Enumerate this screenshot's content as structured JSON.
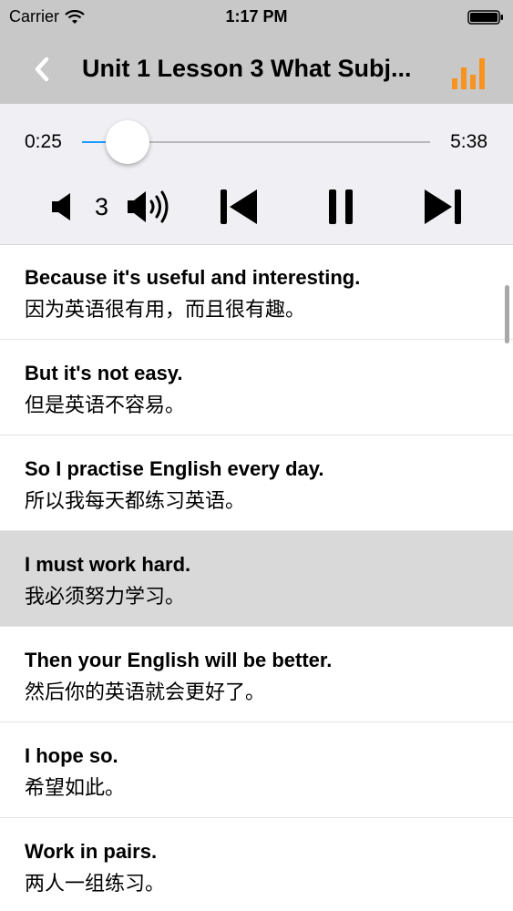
{
  "status_bar": {
    "carrier": "Carrier",
    "time": "1:17 PM"
  },
  "nav": {
    "title": "Unit 1 Lesson 3 What Subj...",
    "back_icon": "chevron-left-icon",
    "chart_icon": "bar-chart-icon",
    "accent_color": "#f7931e"
  },
  "player": {
    "current_time": "0:25",
    "total_time": "5:38",
    "progress_fraction": 0.08,
    "progress_color": "#1a9bff",
    "volume_level": "3"
  },
  "sentences": [
    {
      "en": "Because it's useful and interesting.",
      "zh": "因为英语很有用，而且很有趣。",
      "selected": false
    },
    {
      "en": "But it's not easy.",
      "zh": "但是英语不容易。",
      "selected": false
    },
    {
      "en": "So I practise English every day.",
      "zh": "所以我每天都练习英语。",
      "selected": false
    },
    {
      "en": "I must work hard.",
      "zh": "我必须努力学习。",
      "selected": true
    },
    {
      "en": "Then your English will be better.",
      "zh": "然后你的英语就会更好了。",
      "selected": false
    },
    {
      "en": "I hope so.",
      "zh": "希望如此。",
      "selected": false
    },
    {
      "en": "Work in pairs.",
      "zh": "两人一组练习。",
      "selected": false
    }
  ]
}
